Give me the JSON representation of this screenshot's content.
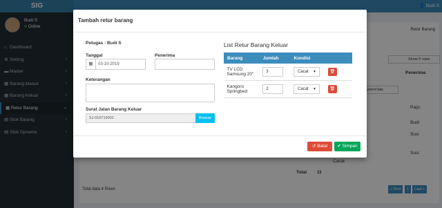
{
  "app": {
    "brand": "SIG",
    "top_user": "Budi S"
  },
  "user_panel": {
    "name": "Budi S",
    "status": "Online"
  },
  "sidebar": {
    "items": [
      {
        "label": "Dashboard",
        "icon": "dashboard-icon"
      },
      {
        "label": "Setting",
        "icon": "cogs-icon"
      },
      {
        "label": "Master",
        "icon": "folder-icon"
      },
      {
        "label": "Barang Masuk",
        "icon": "cubes-icon"
      },
      {
        "label": "Barang Keluar",
        "icon": "cubes-icon"
      },
      {
        "label": "Retur Barang",
        "icon": "cubes-icon"
      },
      {
        "label": "Stok Barang",
        "icon": "file-icon"
      },
      {
        "label": "Stok Opname",
        "icon": "file-icon"
      }
    ]
  },
  "background": {
    "breadcrumb_right": "Retur Barang",
    "show_select": "Show 5 rows",
    "col_penerima": "Penerima",
    "col_partial": "as",
    "search_partial": "k keyword fals",
    "names": [
      "Paijo",
      "Budi",
      "Susi",
      "Susi"
    ],
    "cacat": "Cacat",
    "total_label": "Total",
    "total_value": "11",
    "total_rows": "Total data 4 Rows",
    "pager_first": "« First",
    "pager_page": "1",
    "pager_last": "Last »"
  },
  "modal": {
    "title": "Tambah retur barang",
    "petugas": "Petugas : Budi S",
    "tanggal_label": "Tanggal",
    "tanggal_value": "03-10-2019",
    "penerima_label": "Penerima",
    "penerima_value": "",
    "keterangan_label": "Keterangan",
    "keterangan_value": "",
    "surat_label": "Surat Jalan Barang Keluar",
    "surat_value": "SJ-010719002",
    "browse_label": "Browse",
    "list_title": "List Retur Barang Keluar",
    "table": {
      "headers": [
        "Barang",
        "Jumlah",
        "Kondisi",
        ""
      ],
      "rows": [
        {
          "barang": "TV LCD Samsung 20\"",
          "jumlah": "3",
          "kondisi": "Cacat"
        },
        {
          "barang": "Kangoro Springbed",
          "jumlah": "2",
          "kondisi": "Cacat"
        }
      ]
    },
    "batal_label": "Batal",
    "simpan_label": "Simpan"
  }
}
